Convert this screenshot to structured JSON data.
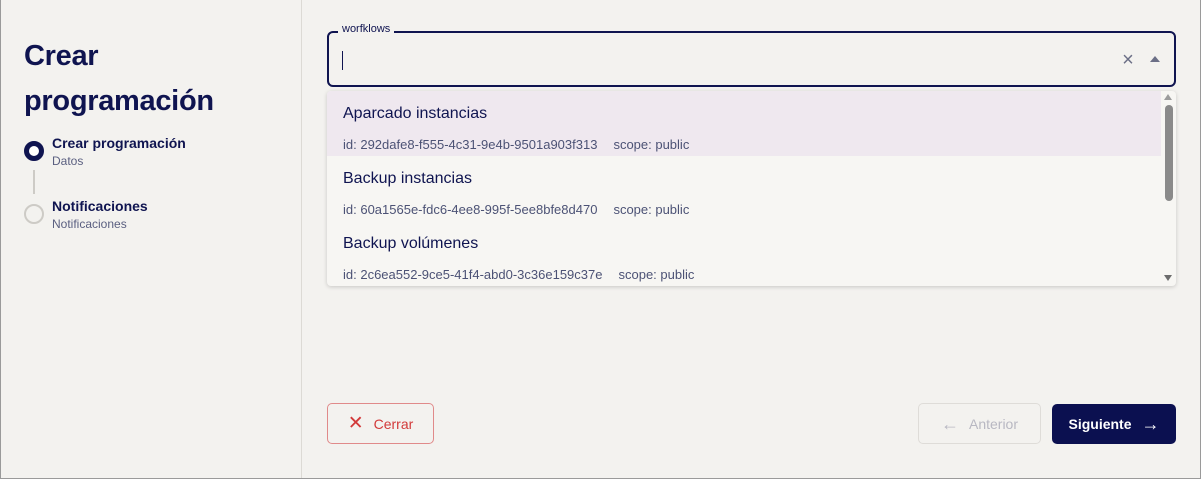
{
  "sidebar": {
    "title": "Crear programación",
    "steps": [
      {
        "title": "Crear programación",
        "subtitle": "Datos",
        "state": "active"
      },
      {
        "title": "Notificaciones",
        "subtitle": "Notificaciones",
        "state": "inactive"
      }
    ]
  },
  "form": {
    "workflow_field": {
      "label": "worfklows",
      "value": "",
      "clear_icon": "close-icon",
      "toggle_icon": "arrow-up-icon"
    },
    "options": [
      {
        "name": "Aparcado instancias",
        "id": "id: 292dafe8-f555-4c31-9e4b-9501a903f313",
        "scope": "scope: public",
        "highlighted": true
      },
      {
        "name": "Backup instancias",
        "id": "id: 60a1565e-fdc6-4ee8-995f-5ee8bfe8d470",
        "scope": "scope: public",
        "highlighted": false
      },
      {
        "name": "Backup volúmenes",
        "id": "id: 2c6ea552-9ce5-41f4-abd0-3c36e159c37e",
        "scope": "scope: public",
        "highlighted": false
      }
    ]
  },
  "footer": {
    "close_label": "Cerrar",
    "prev_label": "Anterior",
    "next_label": "Siguiente"
  },
  "colors": {
    "primary": "#0b1050",
    "danger": "#d23a3a",
    "background": "#f3f2ef",
    "highlight": "#efe8ef"
  }
}
